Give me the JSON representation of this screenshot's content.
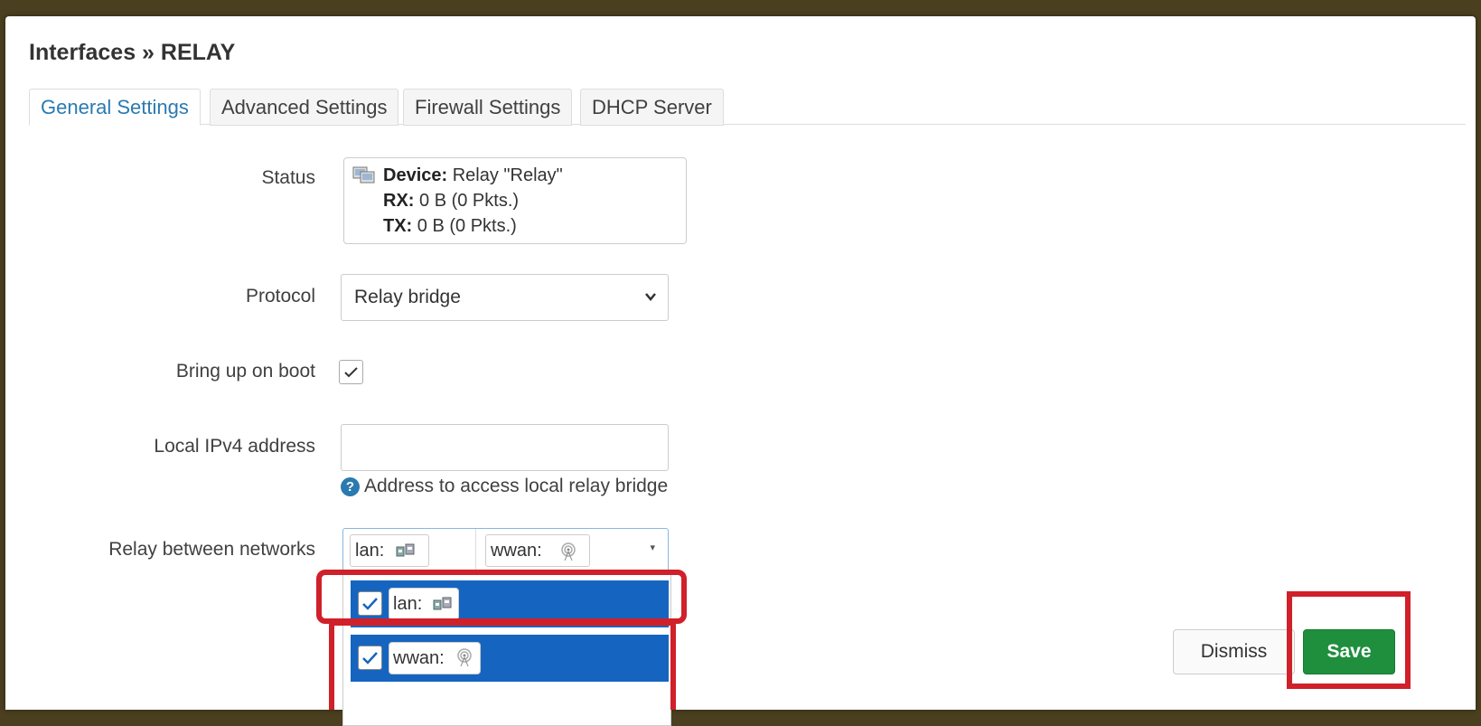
{
  "modal": {
    "title": "Interfaces » RELAY",
    "tabs": [
      {
        "label": "General Settings",
        "active": true
      },
      {
        "label": "Advanced Settings",
        "active": false
      },
      {
        "label": "Firewall Settings",
        "active": false
      },
      {
        "label": "DHCP Server",
        "active": false
      }
    ]
  },
  "form": {
    "status": {
      "label": "Status",
      "icon": "network-device-icon",
      "device_key": "Device:",
      "device_value": "Relay \"Relay\"",
      "rx_key": "RX:",
      "rx_value": "0 B (0 Pkts.)",
      "tx_key": "TX:",
      "tx_value": "0 B (0 Pkts.)"
    },
    "protocol": {
      "label": "Protocol",
      "value": "Relay bridge"
    },
    "bring_up_on_boot": {
      "label": "Bring up on boot",
      "checked": true
    },
    "local_ipv4": {
      "label": "Local IPv4 address",
      "value": "",
      "help": "Address to access local relay bridge"
    },
    "relay_networks": {
      "label": "Relay between networks",
      "selected": [
        {
          "name": "lan:",
          "icon": "ethernet-icon"
        },
        {
          "name": "wwan:",
          "icon": "wireless-icon"
        }
      ],
      "options": [
        {
          "name": "lan:",
          "icon": "ethernet-icon",
          "checked": true
        },
        {
          "name": "wwan:",
          "icon": "wireless-icon",
          "checked": true
        }
      ]
    }
  },
  "footer": {
    "dismiss_label": "Dismiss",
    "save_label": "Save"
  },
  "colors": {
    "tab_active": "#2a7ab0",
    "option_highlight": "#1565c0",
    "save_button": "#1f8f3e",
    "annotation_red": "#d0202a"
  }
}
